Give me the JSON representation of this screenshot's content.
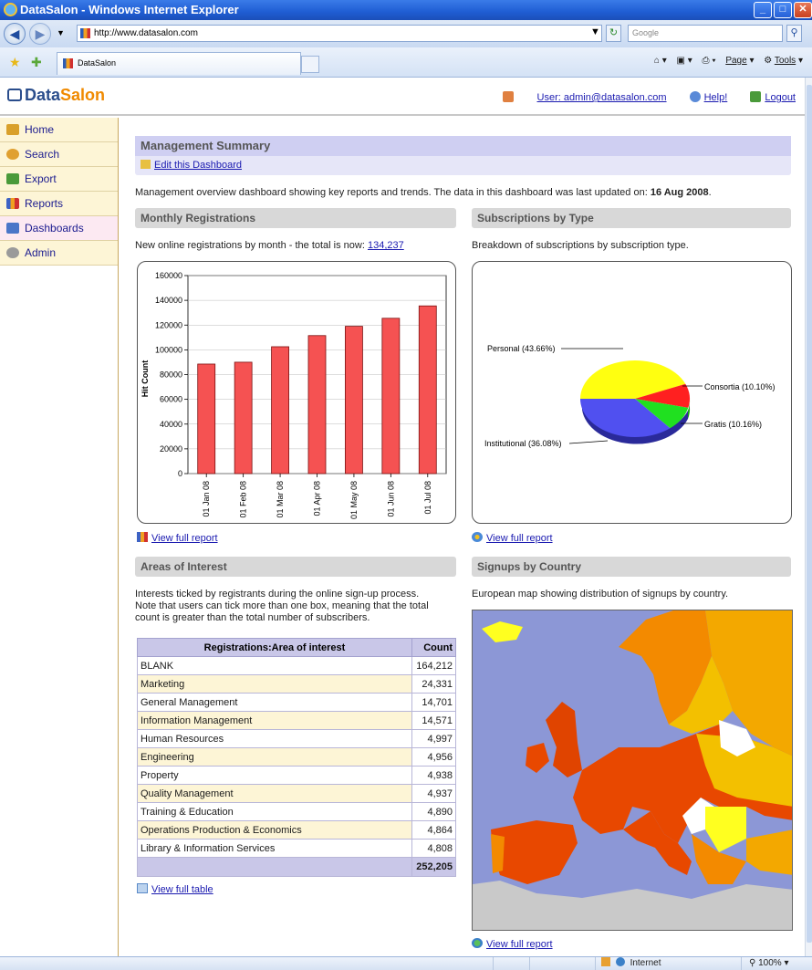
{
  "window": {
    "title": "DataSalon - Windows Internet Explorer"
  },
  "browser": {
    "url": "http://www.datasalon.com",
    "search_placeholder": "Google",
    "tab_title": "DataSalon",
    "command_bar": {
      "page": "Page",
      "tools": "Tools"
    }
  },
  "header": {
    "logo_part1": "Data",
    "logo_part2": "Salon",
    "user_link": "User: admin@datasalon.com",
    "help_link": "Help!",
    "logout_link": "Logout"
  },
  "sidebar": {
    "items": [
      {
        "label": "Home",
        "icon": "home-icon",
        "color": "#d9a02a"
      },
      {
        "label": "Search",
        "icon": "search-icon",
        "color": "#e0a030"
      },
      {
        "label": "Export",
        "icon": "export-icon",
        "color": "#4a9a3a"
      },
      {
        "label": "Reports",
        "icon": "reports-icon",
        "color": "#3d62c4"
      },
      {
        "label": "Dashboards",
        "icon": "dashboards-icon",
        "color": "#4a76c8"
      },
      {
        "label": "Admin",
        "icon": "gear-icon",
        "color": "#9a9a9a"
      }
    ],
    "active": "Dashboards"
  },
  "dashboard": {
    "title": "Management Summary",
    "edit_link": "Edit this Dashboard",
    "intro": "Management overview dashboard showing key reports and trends. The data in this dashboard was last updated on:",
    "updated_date": "16 Aug 2008",
    "intro_end": "."
  },
  "monthly": {
    "heading": "Monthly Registrations",
    "desc": "New online registrations by month - the total is now:",
    "total_link": "134,237",
    "view_link": "View full report"
  },
  "subscriptions": {
    "heading": "Subscriptions by Type",
    "desc": "Breakdown of subscriptions by subscription type.",
    "view_link": "View full report"
  },
  "interest": {
    "heading": "Areas of Interest",
    "desc_line1": "Interests ticked by registrants during the online sign-up process.",
    "desc_line2": "Note that users can tick more than one box, meaning that the total",
    "desc_line3": "count is greater than the total number of subscribers.",
    "col_label": "Registrations:Area of interest",
    "col_count": "Count",
    "rows": [
      {
        "label": "BLANK",
        "count": "164,212"
      },
      {
        "label": "Marketing",
        "count": "24,331"
      },
      {
        "label": "General Management",
        "count": "14,701"
      },
      {
        "label": "Information Management",
        "count": "14,571"
      },
      {
        "label": "Human Resources",
        "count": "4,997"
      },
      {
        "label": "Engineering",
        "count": "4,956"
      },
      {
        "label": "Property",
        "count": "4,938"
      },
      {
        "label": "Quality Management",
        "count": "4,937"
      },
      {
        "label": "Training & Education",
        "count": "4,890"
      },
      {
        "label": "Operations Production & Economics",
        "count": "4,864"
      },
      {
        "label": "Library & Information Services",
        "count": "4,808"
      }
    ],
    "total": "252,205",
    "view_link": "View full table"
  },
  "country": {
    "heading": "Signups by Country",
    "desc": "European map showing distribution of signups by country.",
    "view_link": "View full report"
  },
  "status": {
    "zone": "Internet",
    "zoom": "100%"
  },
  "chart_data": [
    {
      "type": "bar",
      "title": "",
      "xlabel": "",
      "ylabel": "Hit Count",
      "categories": [
        "01 Jan 08",
        "01 Feb 08",
        "01 Mar 08",
        "01 Apr 08",
        "01 May 08",
        "01 Jun 08",
        "01 Jul 08"
      ],
      "values": [
        88500,
        90000,
        102500,
        111500,
        119000,
        125500,
        135500
      ],
      "ylim": [
        0,
        160000
      ],
      "yticks": [
        "0",
        "20000",
        "40000",
        "60000",
        "80000",
        "100000",
        "120000",
        "140000",
        "160000"
      ],
      "grid": true,
      "colors": {
        "bar": "#f55252",
        "bar_edge": "#7a1010"
      }
    },
    {
      "type": "pie",
      "title": "",
      "slices": [
        {
          "label": "Personal (43.66%)",
          "value": 43.66,
          "color": "#ffff10"
        },
        {
          "label": "Consortia (10.10%)",
          "value": 10.1,
          "color": "#ff2020"
        },
        {
          "label": "Gratis (10.16%)",
          "value": 10.16,
          "color": "#20e020"
        },
        {
          "label": "Institutional (36.08%)",
          "value": 36.08,
          "color": "#5050f0"
        }
      ]
    }
  ]
}
